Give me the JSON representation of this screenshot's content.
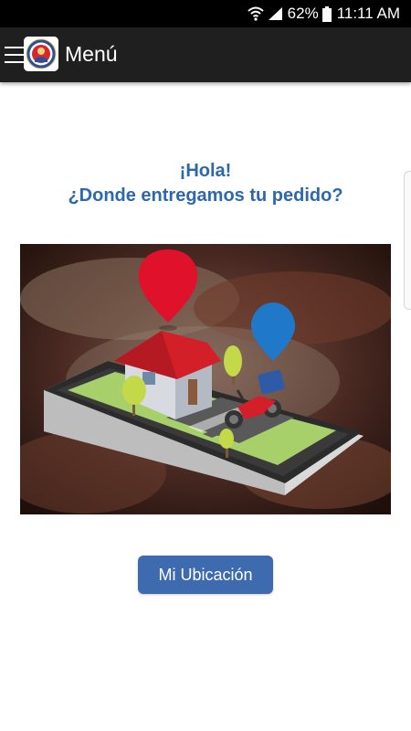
{
  "status_bar": {
    "battery": "62%",
    "time": "11:11 AM"
  },
  "app_bar": {
    "title": "Menú"
  },
  "content": {
    "greeting_line1": "¡Hola!",
    "greeting_line2": "¿Donde entregamos tu pedido?",
    "location_button_label": "Mi Ubicación"
  },
  "colors": {
    "status_bar": "#000000",
    "app_bar": "#1f1f1f",
    "greeting_text": "#2d68ad",
    "button": "#3e6ab0",
    "pin_red": "#e0112b",
    "pin_blue": "#1f78c8"
  },
  "icons": [
    "wifi-icon",
    "signal-icon",
    "battery-icon",
    "hamburger-icon",
    "app-logo-icon",
    "map-pin-red-icon",
    "map-pin-blue-icon"
  ]
}
